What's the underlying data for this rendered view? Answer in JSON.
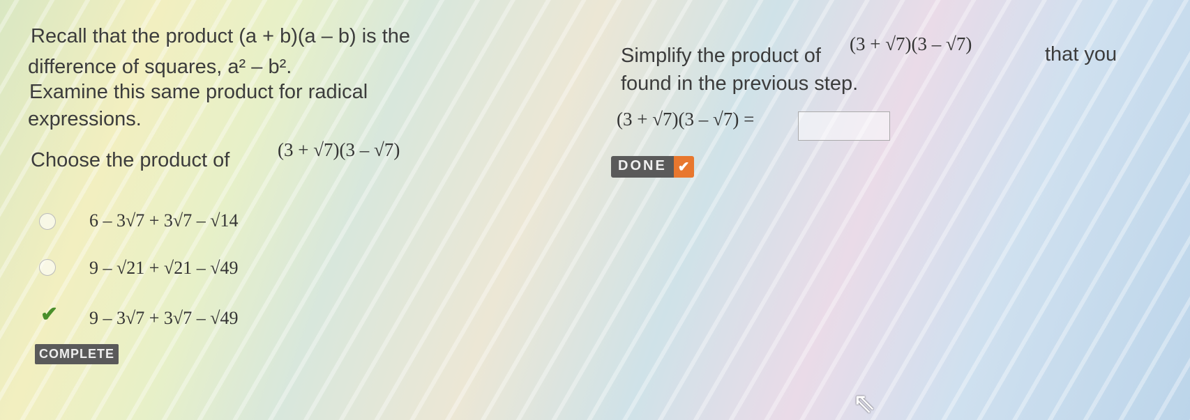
{
  "left": {
    "line1": "Recall that the product (a + b)(a – b) is the",
    "line2": "difference of squares, a² – b².",
    "line3": "Examine this same product for radical",
    "line4": "expressions.",
    "choose_prompt": "Choose the product of",
    "choose_expr": "(3 + √7)(3 – √7)",
    "options": [
      {
        "text": "6 – 3√7 + 3√7 – √14",
        "state": "unselected"
      },
      {
        "text": "9 – √21 + √21 – √49",
        "state": "unselected"
      },
      {
        "text": "9 – 3√7 + 3√7 – √49",
        "state": "correct"
      }
    ],
    "complete_badge": "COMPLETE"
  },
  "right": {
    "line1_prefix": "Simplify the product of",
    "line1_expr": "(3 + √7)(3 – √7)",
    "line1_suffix": "that you",
    "line2": "found in the previous step.",
    "equation": "(3 + √7)(3 – √7) =",
    "answer_value": "",
    "done_label": "DONE",
    "done_icon": "check-icon"
  },
  "colors": {
    "check_green": "#4a8f2b",
    "badge_gray": "#5a5a5a",
    "done_orange": "#e8772e"
  }
}
